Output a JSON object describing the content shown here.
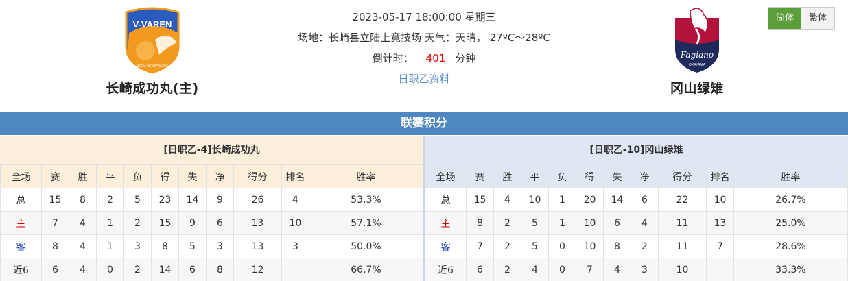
{
  "match": {
    "datetime": "2023-05-17 18:00:00 星期三",
    "venue": "场地：长崎县立陆上竞技场 天气：天晴， 27ºC～28ºC",
    "countdown_label": "倒计时：",
    "countdown_value": "401",
    "countdown_unit": "分钟",
    "league_link": "日职乙资料"
  },
  "home_team": {
    "name": "长崎成功丸(主)",
    "logo_text": "V-VAREN",
    "logo_sub": "2005 NAGASAKI"
  },
  "away_team": {
    "name": "冈山绿雉",
    "logo_text": "Fagiano",
    "logo_sub": "OKAYAMA"
  },
  "lang": {
    "simplified": "简体",
    "traditional": "繁体"
  },
  "colors": {
    "accent_blue": "#4f87c2",
    "active_green": "#5b9e3a",
    "home_red": "#d40000",
    "away_blue": "#1a3fb0"
  },
  "section_title": "联赛积分",
  "columns": [
    "全场",
    "赛",
    "胜",
    "平",
    "负",
    "得",
    "失",
    "净",
    "得分",
    "排名",
    "胜率"
  ],
  "home_standings": {
    "title": "[日职乙-4]长崎成功丸",
    "rows": [
      [
        "总",
        "15",
        "8",
        "2",
        "5",
        "23",
        "14",
        "9",
        "26",
        "4",
        "53.3%"
      ],
      [
        "主",
        "7",
        "4",
        "1",
        "2",
        "15",
        "9",
        "6",
        "13",
        "10",
        "57.1%"
      ],
      [
        "客",
        "8",
        "4",
        "1",
        "3",
        "8",
        "5",
        "3",
        "13",
        "3",
        "50.0%"
      ],
      [
        "近6",
        "6",
        "4",
        "0",
        "2",
        "14",
        "6",
        "8",
        "12",
        "",
        "66.7%"
      ]
    ]
  },
  "away_standings": {
    "title": "[日职乙-10]冈山绿雉",
    "rows": [
      [
        "总",
        "15",
        "4",
        "10",
        "1",
        "20",
        "14",
        "6",
        "22",
        "10",
        "26.7%"
      ],
      [
        "主",
        "8",
        "2",
        "5",
        "1",
        "10",
        "6",
        "4",
        "11",
        "13",
        "25.0%"
      ],
      [
        "客",
        "7",
        "2",
        "5",
        "0",
        "10",
        "8",
        "2",
        "11",
        "7",
        "28.6%"
      ],
      [
        "近6",
        "6",
        "2",
        "4",
        "0",
        "7",
        "4",
        "3",
        "10",
        "",
        "33.3%"
      ]
    ]
  }
}
